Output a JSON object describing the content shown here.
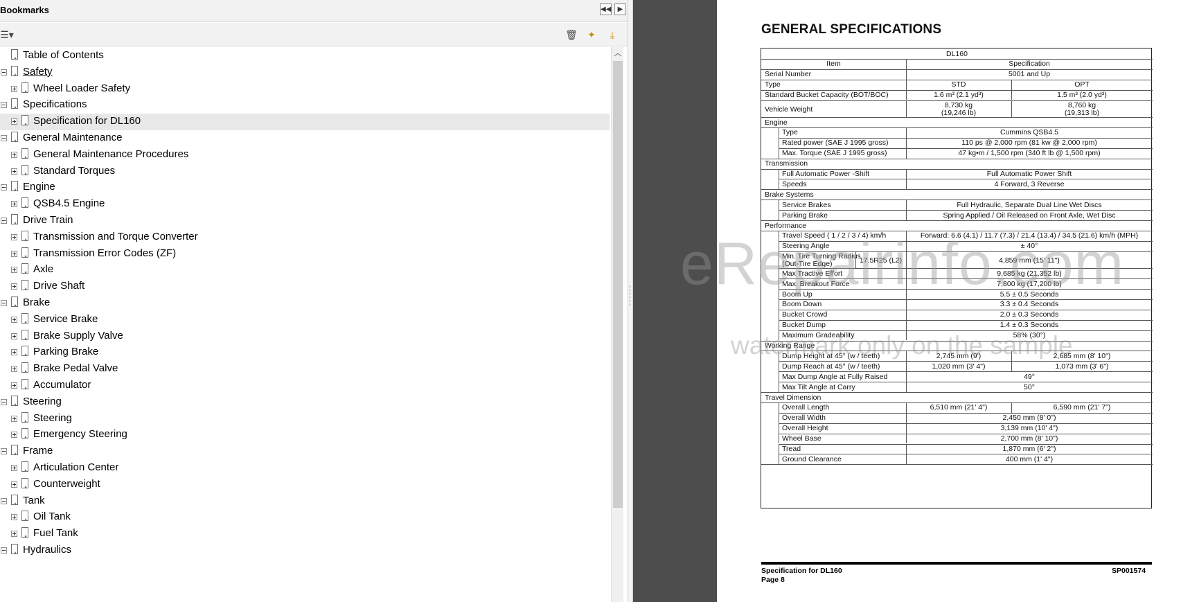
{
  "panel": {
    "title": "Bookmarks",
    "nav_prev_icon": "double-left-arrow",
    "nav_next_icon": "right-arrow"
  },
  "bookmarks": [
    {
      "label": "Table of Contents",
      "level": 0,
      "expander": "none"
    },
    {
      "label": "Safety",
      "level": 0,
      "expander": "minus",
      "underlined": true
    },
    {
      "label": "Wheel Loader Safety",
      "level": 1,
      "expander": "plus"
    },
    {
      "label": "Specifications",
      "level": 0,
      "expander": "minus"
    },
    {
      "label": "Specification for DL160",
      "level": 1,
      "expander": "plus",
      "selected": true
    },
    {
      "label": "General Maintenance",
      "level": 0,
      "expander": "minus"
    },
    {
      "label": "General Maintenance Procedures",
      "level": 1,
      "expander": "plus"
    },
    {
      "label": "Standard Torques",
      "level": 1,
      "expander": "plus"
    },
    {
      "label": "Engine",
      "level": 0,
      "expander": "minus"
    },
    {
      "label": "QSB4.5 Engine",
      "level": 1,
      "expander": "plus"
    },
    {
      "label": "Drive Train",
      "level": 0,
      "expander": "minus"
    },
    {
      "label": "Transmission and Torque Converter",
      "level": 1,
      "expander": "plus"
    },
    {
      "label": "Transmission Error Codes (ZF)",
      "level": 1,
      "expander": "plus"
    },
    {
      "label": "Axle",
      "level": 1,
      "expander": "plus"
    },
    {
      "label": "Drive Shaft",
      "level": 1,
      "expander": "plus"
    },
    {
      "label": "Brake",
      "level": 0,
      "expander": "minus"
    },
    {
      "label": "Service Brake",
      "level": 1,
      "expander": "plus"
    },
    {
      "label": "Brake Supply Valve",
      "level": 1,
      "expander": "plus"
    },
    {
      "label": "Parking Brake",
      "level": 1,
      "expander": "plus"
    },
    {
      "label": "Brake Pedal Valve",
      "level": 1,
      "expander": "plus"
    },
    {
      "label": "Accumulator",
      "level": 1,
      "expander": "plus"
    },
    {
      "label": "Steering",
      "level": 0,
      "expander": "minus"
    },
    {
      "label": "Steering",
      "level": 1,
      "expander": "plus"
    },
    {
      "label": "Emergency Steering",
      "level": 1,
      "expander": "plus"
    },
    {
      "label": "Frame",
      "level": 0,
      "expander": "minus"
    },
    {
      "label": "Articulation Center",
      "level": 1,
      "expander": "plus"
    },
    {
      "label": "Counterweight",
      "level": 1,
      "expander": "plus"
    },
    {
      "label": "Tank",
      "level": 0,
      "expander": "minus"
    },
    {
      "label": "Oil Tank",
      "level": 1,
      "expander": "plus"
    },
    {
      "label": "Fuel Tank",
      "level": 1,
      "expander": "plus"
    },
    {
      "label": "Hydraulics",
      "level": 0,
      "expander": "minus"
    }
  ],
  "document": {
    "title": "GENERAL SPECIFICATIONS",
    "model": "DL160",
    "header_item": "Item",
    "header_spec": "Specification",
    "rows": [
      {
        "kind": "full",
        "label": "Serial Number",
        "value": "5001 and Up"
      },
      {
        "kind": "split",
        "label": "Type",
        "std": "STD",
        "opt": "OPT"
      },
      {
        "kind": "split",
        "label": "Standard Bucket Capacity (BOT/BOC)",
        "std": "1.6 m³ (2.1 yd³)",
        "opt": "1.5 m³ (2.0 yd³)"
      },
      {
        "kind": "split2",
        "label": "Vehicle Weight",
        "std": "8,730 kg",
        "std2": "(19,246 lb)",
        "opt": "8,760 kg",
        "opt2": "(19,313 lb)"
      },
      {
        "kind": "section",
        "label": "Engine"
      },
      {
        "kind": "sub",
        "label": "Type",
        "value": "Cummins QSB4.5"
      },
      {
        "kind": "sub",
        "label": "Rated power (SAE J 1995 gross)",
        "value": "110 ps @ 2,000 rpm (81 kw @ 2,000 rpm)"
      },
      {
        "kind": "sub",
        "label": "Max. Torque (SAE J 1995 gross)",
        "value": "47 kg•m / 1,500 rpm (340 ft lb @ 1,500 rpm)"
      },
      {
        "kind": "section",
        "label": "Transmission"
      },
      {
        "kind": "sub",
        "label": "Full Automatic Power -Shift",
        "value": "Full Automatic Power Shift"
      },
      {
        "kind": "sub",
        "label": "Speeds",
        "value": "4 Forward, 3 Reverse"
      },
      {
        "kind": "section",
        "label": "Brake Systems"
      },
      {
        "kind": "sub",
        "label": "Service Brakes",
        "value": "Full Hydraulic, Separate Dual Line Wet Discs"
      },
      {
        "kind": "sub",
        "label": "Parking Brake",
        "value": "Spring Applied / Oil Released on Front Axle, Wet Disc"
      },
      {
        "kind": "section",
        "label": "Performance"
      },
      {
        "kind": "sub",
        "label": "Travel Speed ( 1 / 2 / 3 / 4) km/h",
        "value": "Forward: 6.6 (4.1) / 11.7 (7.3) / 21.4 (13.4) / 34.5 (21.6) km/h (MPH)"
      },
      {
        "kind": "sub",
        "label": "Steering Angle",
        "value": "± 40°"
      },
      {
        "kind": "subtire",
        "label": "Min. Tire Turning Radius",
        "label2": "(Out-Tire Edge)",
        "tire": "17.5R25 (L2)",
        "value": "4,859 mm (15' 11\")"
      },
      {
        "kind": "sub",
        "label": "Max Tractive Effort",
        "value": "9,685 kg (21,352 lb)"
      },
      {
        "kind": "sub",
        "label": "Max. Breakout Force",
        "value": "7,800 kg (17,200 lb)"
      },
      {
        "kind": "sub",
        "label": "Boom Up",
        "value": "5.5 ± 0.5 Seconds"
      },
      {
        "kind": "sub",
        "label": "Boom Down",
        "value": "3.3 ± 0.4 Seconds"
      },
      {
        "kind": "sub",
        "label": "Bucket Crowd",
        "value": "2.0 ± 0.3 Seconds"
      },
      {
        "kind": "sub",
        "label": "Bucket Dump",
        "value": "1.4 ± 0.3 Seconds"
      },
      {
        "kind": "sub",
        "label": "Maximum Gradeability",
        "value": "58% (30°)"
      },
      {
        "kind": "section",
        "label": "Working Range"
      },
      {
        "kind": "subsplit",
        "label": "Dump Height at 45° (w / teeth)",
        "std": "2,745 mm (9')",
        "opt": "2,685 mm (8' 10\")"
      },
      {
        "kind": "subsplit",
        "label": "Dump Reach at 45° (w / teeth)",
        "std": "1,020 mm (3' 4\")",
        "opt": "1,073 mm (3' 6\")"
      },
      {
        "kind": "sub",
        "label": "Max Dump Angle at Fully Raised",
        "value": "49°"
      },
      {
        "kind": "sub",
        "label": "Max Tilt Angle at Carry",
        "value": "50°"
      },
      {
        "kind": "section",
        "label": "Travel Dimension"
      },
      {
        "kind": "subsplit",
        "label": "Overall Length",
        "std": "6,510  mm (21' 4\")",
        "opt": "6,590 mm (21' 7\")"
      },
      {
        "kind": "sub",
        "label": "Overall Width",
        "value": "2,450 mm (8' 0\")"
      },
      {
        "kind": "sub",
        "label": "Overall Height",
        "value": "3,139 mm (10' 4\")"
      },
      {
        "kind": "sub",
        "label": "Wheel Base",
        "value": "2,700 mm (8' 10\")"
      },
      {
        "kind": "sub",
        "label": "Tread",
        "value": "1,870 mm (6' 2\")"
      },
      {
        "kind": "sub",
        "label": "Ground Clearance",
        "value": "400 mm (1' 4\")"
      }
    ],
    "footer_left1": "Specification for DL160",
    "footer_left2": "Page 8",
    "footer_right": "SP001574",
    "watermark_main": "eRepairinfo.com",
    "watermark_sub": "watermark only on the sample"
  }
}
